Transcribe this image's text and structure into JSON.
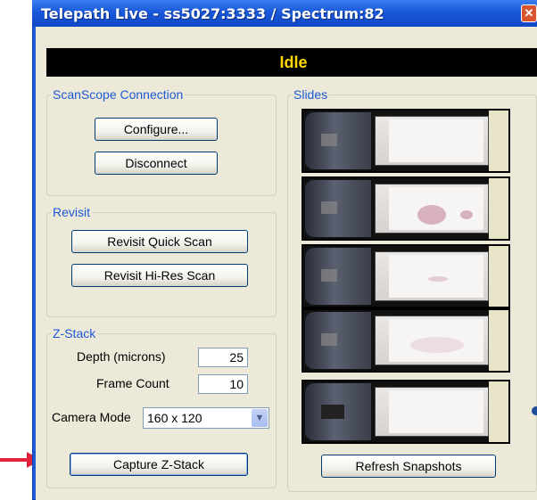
{
  "window": {
    "title": "Telepath Live  - ss5027:3333 / Spectrum:82",
    "close_glyph": "✕"
  },
  "status": "Idle",
  "scanscope": {
    "legend": "ScanScope Connection",
    "configure_label": "Configure...",
    "disconnect_label": "Disconnect"
  },
  "revisit": {
    "legend": "Revisit",
    "quick_label": "Revisit Quick Scan",
    "hires_label": "Revisit Hi-Res Scan"
  },
  "zstack": {
    "legend": "Z-Stack",
    "depth_label": "Depth (microns)",
    "depth_value": "25",
    "frame_label": "Frame Count",
    "frame_value": "10",
    "camera_label": "Camera Mode",
    "camera_value": "160 x 120",
    "capture_label": "Capture Z-Stack"
  },
  "slides": {
    "legend": "Slides",
    "refresh_label": "Refresh Snapshots",
    "thumbnails": [
      {
        "id": "slide-1",
        "selected": false
      },
      {
        "id": "slide-2",
        "selected": false
      },
      {
        "id": "slide-3",
        "selected": false
      },
      {
        "id": "slide-4",
        "selected": false
      },
      {
        "id": "slide-5",
        "selected": true
      }
    ]
  },
  "colors": {
    "title_bar": "#1f5bd6",
    "status_bg": "#000000",
    "status_text": "#ffd800",
    "group_legend": "#1c5ad8",
    "pointer_arrow": "#e0233a"
  },
  "icons": {
    "close": "close-icon",
    "dropdown": "chevron-down-icon",
    "pointer": "arrow-right-icon",
    "selection": "selected-dot-icon"
  }
}
